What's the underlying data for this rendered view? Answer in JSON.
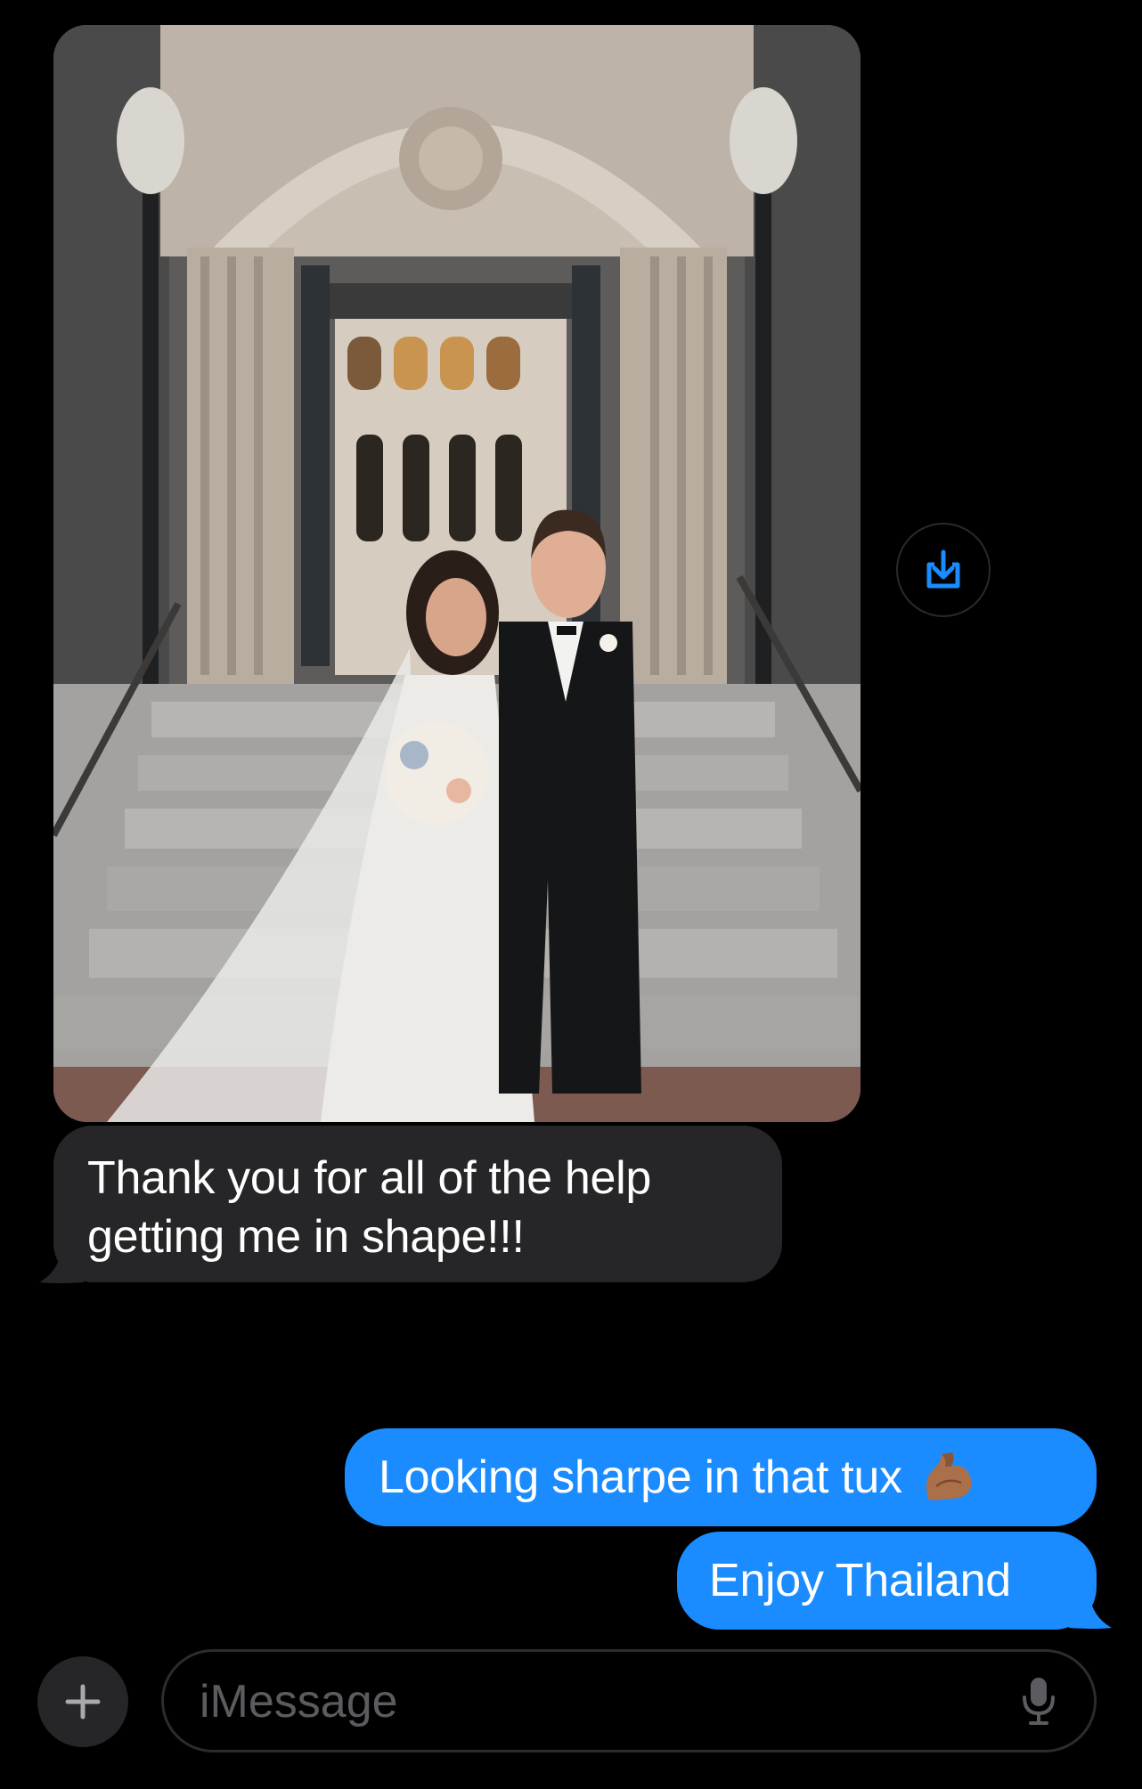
{
  "thread": {
    "received_photo": {
      "icon": "wedding-photo"
    },
    "save_button": {
      "icon": "download-icon",
      "accent": "#1a8cff"
    },
    "incoming_message": {
      "line1": "Thank you for all of the help",
      "line2": "getting me in shape!!!",
      "bubble_color": "#262628"
    },
    "outgoing_messages": [
      {
        "text": "Looking sharpe in that tux",
        "emoji": "flexed-biceps-medium-dark-skin"
      },
      {
        "text": "Enjoy Thailand"
      }
    ],
    "outgoing_bubble_color": "#1a8cff"
  },
  "composer": {
    "plus_icon": "plus-icon",
    "placeholder": "iMessage",
    "value": "",
    "mic_icon": "microphone-icon"
  }
}
